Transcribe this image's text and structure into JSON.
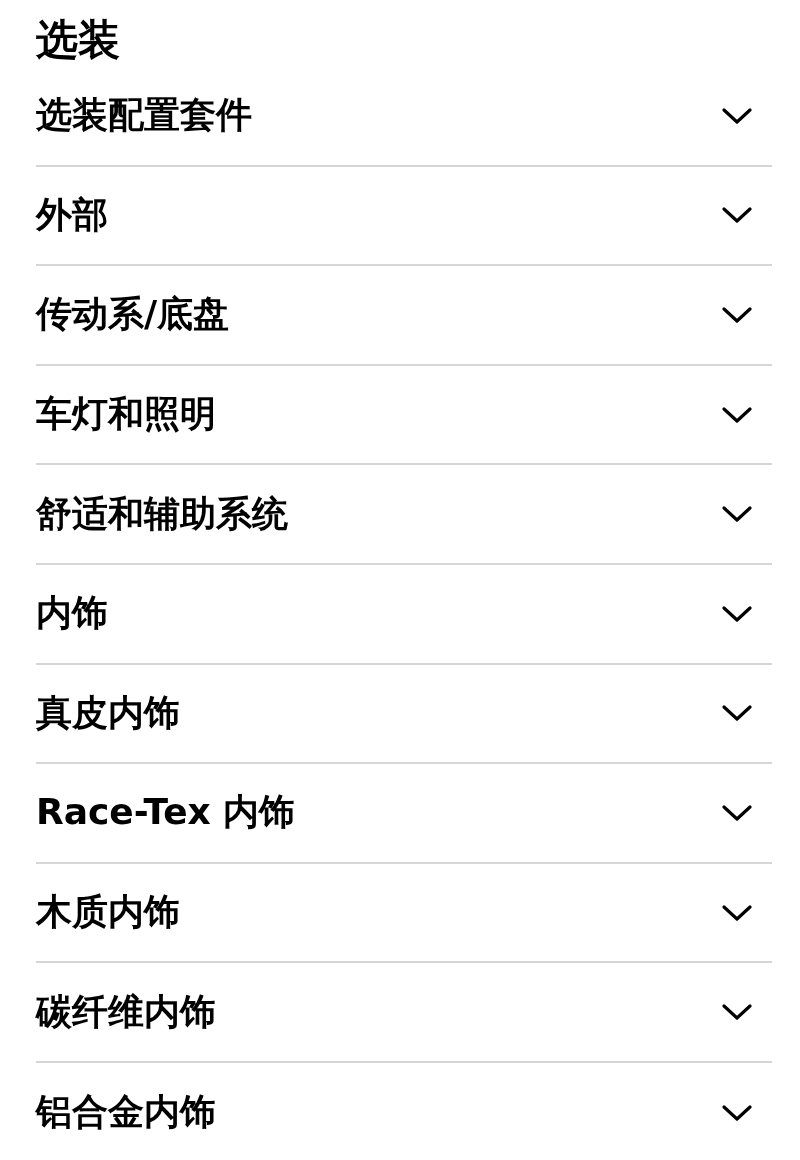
{
  "title": "选装",
  "sections": [
    {
      "label": "选装配置套件",
      "expanded": false
    },
    {
      "label": "外部",
      "expanded": false
    },
    {
      "label": "传动系/底盘",
      "expanded": false
    },
    {
      "label": "车灯和照明",
      "expanded": false
    },
    {
      "label": "舒适和辅助系统",
      "expanded": false
    },
    {
      "label": "内饰",
      "expanded": false
    },
    {
      "label": "真皮内饰",
      "expanded": false
    },
    {
      "label": "Race-Tex 内饰",
      "expanded": false
    },
    {
      "label": "木质内饰",
      "expanded": false
    },
    {
      "label": "碳纤维内饰",
      "expanded": false
    },
    {
      "label": "铝合金内饰",
      "expanded": false
    }
  ]
}
